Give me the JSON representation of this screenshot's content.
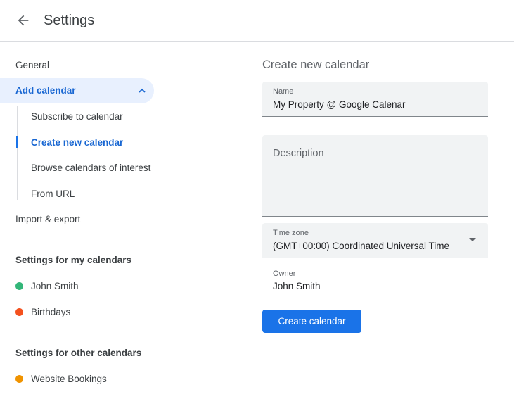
{
  "header": {
    "title": "Settings"
  },
  "sidebar": {
    "general": "General",
    "add_calendar": "Add calendar",
    "sub_items": [
      "Subscribe to calendar",
      "Create new calendar",
      "Browse calendars of interest",
      "From URL"
    ],
    "import_export": "Import & export",
    "my_calendars_heading": "Settings for my calendars",
    "my_calendars": [
      {
        "name": "John Smith",
        "color": "#33b679"
      },
      {
        "name": "Birthdays",
        "color": "#f4511e"
      }
    ],
    "other_calendars_heading": "Settings for other calendars",
    "other_calendars": [
      {
        "name": "Website Bookings",
        "color": "#f09300"
      }
    ]
  },
  "main": {
    "heading": "Create new calendar",
    "name_label": "Name",
    "name_value": "My Property @ Google Calenar",
    "description_placeholder": "Description",
    "timezone_label": "Time zone",
    "timezone_value": "(GMT+00:00) Coordinated Universal Time",
    "owner_label": "Owner",
    "owner_value": "John Smith",
    "create_button": "Create calendar"
  }
}
